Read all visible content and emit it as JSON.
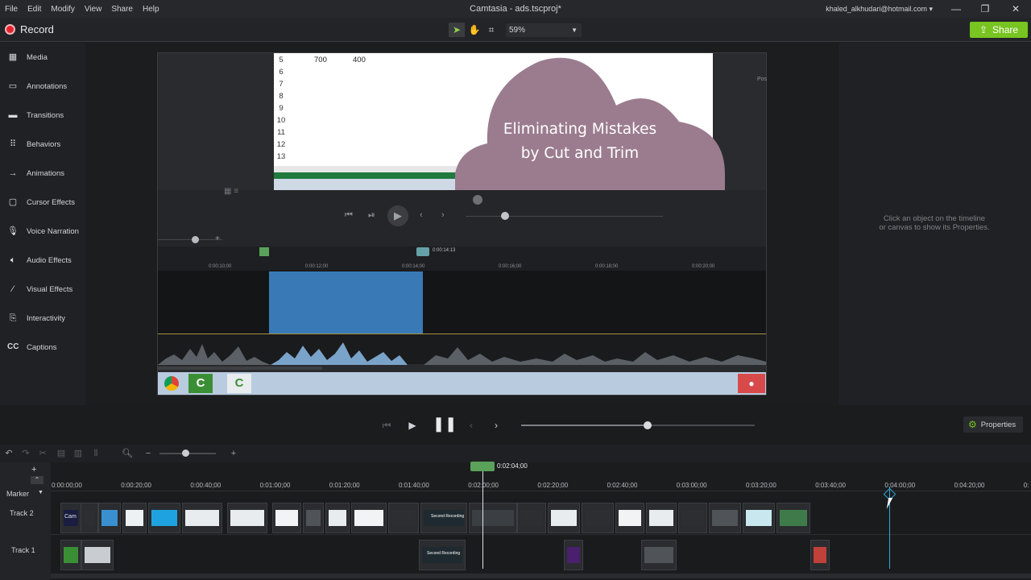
{
  "menu": [
    "File",
    "Edit",
    "Modify",
    "View",
    "Share",
    "Help"
  ],
  "app_title": "Camtasia - ads.tscproj*",
  "account": "khaled_alkhudari@hotmail.com ▾",
  "toolbar": {
    "record_label": "Record",
    "zoom": "59%",
    "share_label": "Share"
  },
  "sidebar": {
    "items": [
      {
        "label": "Media",
        "icon": "film-icon"
      },
      {
        "label": "Annotations",
        "icon": "annotation-icon"
      },
      {
        "label": "Transitions",
        "icon": "transition-icon"
      },
      {
        "label": "Behaviors",
        "icon": "behavior-icon"
      },
      {
        "label": "Animations",
        "icon": "animation-icon"
      },
      {
        "label": "Cursor Effects",
        "icon": "cursor-icon"
      },
      {
        "label": "Voice Narration",
        "icon": "microphone-icon"
      },
      {
        "label": "Audio Effects",
        "icon": "speaker-icon"
      },
      {
        "label": "Visual Effects",
        "icon": "wand-icon"
      },
      {
        "label": "Interactivity",
        "icon": "interactivity-icon"
      },
      {
        "label": "Captions",
        "icon": "cc-icon"
      }
    ]
  },
  "canvas": {
    "sheet_rows": [
      "5",
      "6",
      "7",
      "8",
      "9",
      "10",
      "11",
      "12",
      "13"
    ],
    "cell_a": "700",
    "cell_b": "400",
    "callout_line1": "Eliminating Mistakes",
    "callout_line2": "by Cut and Trim",
    "inner_playhead_time": "0:00:14:13",
    "inner_ticks": [
      "0:00:10;00",
      "0:00:12;00",
      "0:00:14;00",
      "0:00:16;00",
      "0:00:18;00",
      "0:00:20;00"
    ],
    "side_text": "Pos"
  },
  "properties": {
    "hint_line1": "Click an object on the timeline",
    "hint_line2": "or canvas to show its Properties.",
    "button_label": "Properties"
  },
  "timeline": {
    "playhead_time": "0:02:04;00",
    "ticks": [
      "0:00:00;00",
      "0:00:20;00",
      "0:00:40;00",
      "0:01:00;00",
      "0:01:20;00",
      "0:01:40;00",
      "0:02:00;00",
      "0:02:20;00",
      "0:02:40;00",
      "0:03:00;00",
      "0:03:20;00",
      "0:03:40;00",
      "0:04:00;00",
      "0:04:20;00",
      "0:"
    ],
    "marker_label": "Marker",
    "tracks": [
      "Track 2",
      "Track 1"
    ],
    "track2_first_clip": "Cam",
    "track1_clip_label": "Second Recording",
    "track2_clip_label": "Second Recording"
  }
}
